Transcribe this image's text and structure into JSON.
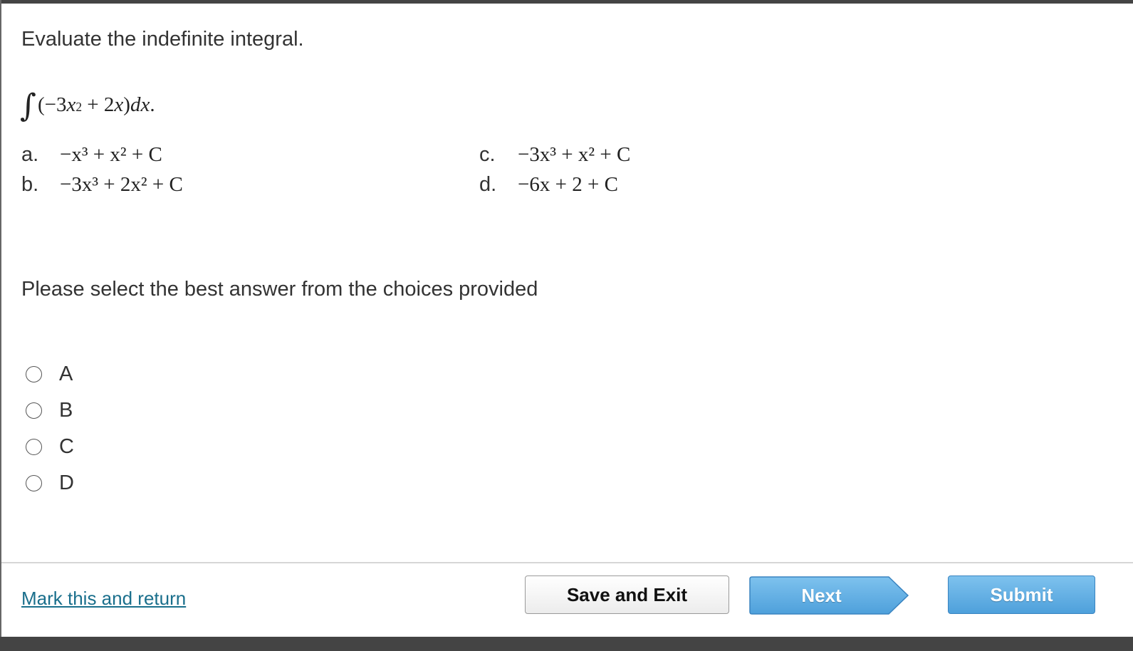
{
  "question": {
    "prompt": "Evaluate the indefinite integral.",
    "integral": {
      "sign": "∫",
      "open": "(−3",
      "var1": "x",
      "exp1": "2",
      "mid": " + 2",
      "var2": "x",
      "close": ")",
      "diff": "dx",
      "end": "."
    }
  },
  "choices": [
    {
      "letter": "a.",
      "expression": "−x³ + x² + C"
    },
    {
      "letter": "b.",
      "expression": "−3x³ + 2x² + C"
    },
    {
      "letter": "c.",
      "expression": "−3x³ + x² + C"
    },
    {
      "letter": "d.",
      "expression": "−6x + 2 + C"
    }
  ],
  "instruction": "Please select the best answer from the choices provided",
  "options": [
    "A",
    "B",
    "C",
    "D"
  ],
  "footer": {
    "mark_link": "Mark this and return",
    "save_exit": "Save and Exit",
    "next": "Next",
    "submit": "Submit"
  },
  "colors": {
    "frame": "#444444",
    "link": "#1a6f8c",
    "primary_button": "#5aa9e0"
  }
}
